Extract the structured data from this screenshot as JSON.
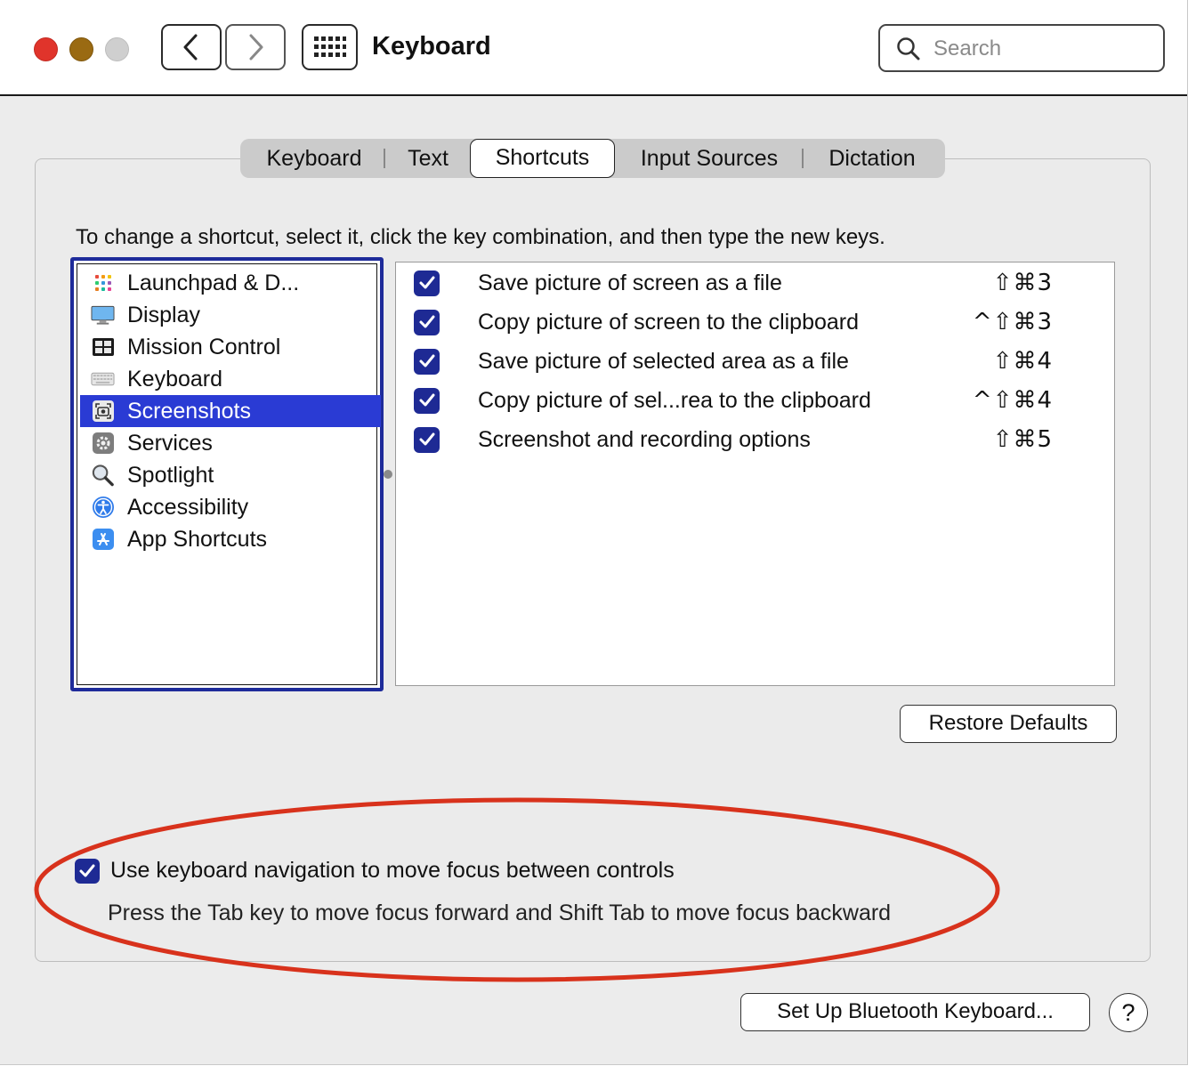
{
  "window": {
    "title": "Keyboard",
    "traffic_lights": [
      "close",
      "minimize",
      "zoom"
    ]
  },
  "toolbar": {
    "back_icon": "chevron-left-icon",
    "forward_icon": "chevron-right-icon",
    "grid_icon": "show-all-grid-icon",
    "search_placeholder": "Search",
    "search_value": ""
  },
  "tabs": [
    {
      "label": "Keyboard",
      "active": false
    },
    {
      "label": "Text",
      "active": false
    },
    {
      "label": "Shortcuts",
      "active": true
    },
    {
      "label": "Input Sources",
      "active": false
    },
    {
      "label": "Dictation",
      "active": false
    }
  ],
  "instructions": "To change a shortcut, select it, click the key combination, and then type the new keys.",
  "categories": [
    {
      "label": "Launchpad & D...",
      "icon": "launchpad-icon",
      "selected": false
    },
    {
      "label": "Display",
      "icon": "display-icon",
      "selected": false
    },
    {
      "label": "Mission Control",
      "icon": "mission-control-icon",
      "selected": false
    },
    {
      "label": "Keyboard",
      "icon": "keyboard-icon",
      "selected": false
    },
    {
      "label": "Screenshots",
      "icon": "screenshot-icon",
      "selected": true
    },
    {
      "label": "Services",
      "icon": "gear-icon",
      "selected": false
    },
    {
      "label": "Spotlight",
      "icon": "magnifier-icon",
      "selected": false
    },
    {
      "label": "Accessibility",
      "icon": "accessibility-icon",
      "selected": false
    },
    {
      "label": "App Shortcuts",
      "icon": "app-store-icon",
      "selected": false
    }
  ],
  "shortcuts": [
    {
      "label": "Save picture of screen as a file",
      "keys": "⇧⌘3",
      "checked": true
    },
    {
      "label": "Copy picture of screen to the clipboard",
      "keys": "^⇧⌘3",
      "checked": true
    },
    {
      "label": "Save picture of selected area as a file",
      "keys": "⇧⌘4",
      "checked": true
    },
    {
      "label": "Copy picture of sel...rea to the clipboard",
      "keys": "^⇧⌘4",
      "checked": true
    },
    {
      "label": "Screenshot and recording options",
      "keys": "⇧⌘5",
      "checked": true
    }
  ],
  "buttons": {
    "restore_defaults": "Restore Defaults",
    "bluetooth_setup": "Set Up Bluetooth Keyboard...",
    "help": "?"
  },
  "keyboard_navigation": {
    "label": "Use keyboard navigation to move focus between controls",
    "checked": true,
    "hint": "Press the Tab key to move focus forward and Shift Tab to move focus backward"
  },
  "colors": {
    "selection": "#2a3bd4",
    "checkbox": "#1e2a94",
    "focus_ring": "#1e2b9a",
    "annotation_ellipse": "#d8321c"
  }
}
